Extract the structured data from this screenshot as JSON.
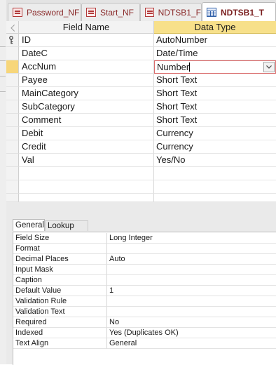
{
  "tabs": [
    {
      "label": "Password_NF",
      "icon": "form-icon",
      "active": false
    },
    {
      "label": "Start_NF",
      "icon": "form-icon",
      "active": false
    },
    {
      "label": "NDTSB1_F",
      "icon": "form-icon",
      "active": false
    },
    {
      "label": "NDTSB1_T",
      "icon": "table-icon",
      "active": true
    }
  ],
  "grid": {
    "headers": {
      "field_name": "Field Name",
      "data_type": "Data Type"
    },
    "rows": [
      {
        "field": "ID",
        "type": "AutoNumber",
        "primary_key": true
      },
      {
        "field": "DateC",
        "type": "Date/Time"
      },
      {
        "field": "AccNum",
        "type": "Number",
        "current": true
      },
      {
        "field": "Payee",
        "type": "Short Text"
      },
      {
        "field": "MainCategory",
        "type": "Short Text"
      },
      {
        "field": "SubCategory",
        "type": "Short Text"
      },
      {
        "field": "Comment",
        "type": "Short Text"
      },
      {
        "field": "Debit",
        "type": "Currency"
      },
      {
        "field": "Credit",
        "type": "Currency"
      },
      {
        "field": "Val",
        "type": "Yes/No"
      }
    ]
  },
  "properties": {
    "tabs": {
      "general": "General",
      "lookup": "Lookup"
    },
    "rows": [
      {
        "label": "Field Size",
        "value": "Long Integer"
      },
      {
        "label": "Format",
        "value": ""
      },
      {
        "label": "Decimal Places",
        "value": "Auto"
      },
      {
        "label": "Input Mask",
        "value": ""
      },
      {
        "label": "Caption",
        "value": ""
      },
      {
        "label": "Default Value",
        "value": "1"
      },
      {
        "label": "Validation Rule",
        "value": ""
      },
      {
        "label": "Validation Text",
        "value": ""
      },
      {
        "label": "Required",
        "value": "No"
      },
      {
        "label": "Indexed",
        "value": "Yes (Duplicates OK)"
      },
      {
        "label": "Text Align",
        "value": "General"
      }
    ]
  },
  "colors": {
    "accent_header": "#f7e08a",
    "current_row_marker": "#f7d67a",
    "tab_text": "#8a2a2a"
  }
}
